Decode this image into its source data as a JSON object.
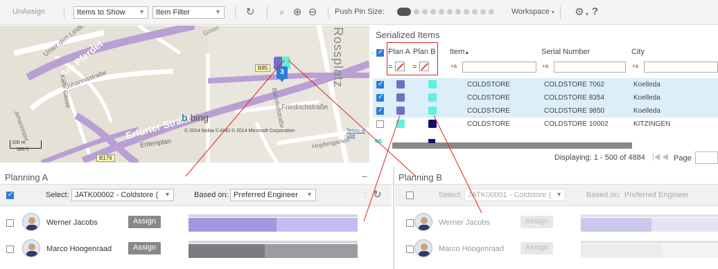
{
  "toolbar": {
    "unassign": "UnAssign",
    "items_to_show": "Items to Show",
    "item_filter": "Item Filter",
    "push_pin_size": "Push Pin Size:",
    "workspace": "Workspace",
    "help": "?"
  },
  "map": {
    "streets": [
      "Unter den Linden",
      "Am Pferdet",
      "Johannisstraße",
      "Kalte Gasse",
      "Erfurter Straße",
      "Entenplan",
      "Rossplatz",
      "Friedrichstraße",
      "Bahnhofstraße",
      "Hopfengarten",
      "Johannistor",
      "Gotter"
    ],
    "road_badges": [
      "B85",
      "B176"
    ],
    "pin_count": "3",
    "bing": "bing",
    "copyright": "© 2014 Nokia © AND © 2014 Microsoft Corporation",
    "terms": "Terms of Use",
    "scale_m": "100 m",
    "scale_ft": "500 ft"
  },
  "grid": {
    "title": "Serialized Items",
    "columns": {
      "plan_a": "Plan A",
      "plan_b": "Plan B",
      "item": "Item",
      "serial": "Serial Number",
      "city": "City"
    },
    "filter_op": "=",
    "text_op": "+a",
    "rows": [
      {
        "checked": true,
        "plan_a": "#6f6fc8",
        "plan_b": "#5ff0e0",
        "item": "COLDSTORE",
        "serial": "COLDSTORE 7062",
        "city": "Koelleda",
        "selected": true
      },
      {
        "checked": true,
        "plan_a": "#6f6fc8",
        "plan_b": "#5ff0e0",
        "item": "COLDSTORE",
        "serial": "COLDSTORE 8354",
        "city": "Koelleda",
        "selected": true
      },
      {
        "checked": true,
        "plan_a": "#6f6fc8",
        "plan_b": "#5ff0e0",
        "item": "COLDSTORE",
        "serial": "COLDSTORE 9850",
        "city": "Koelleda",
        "selected": true
      },
      {
        "checked": false,
        "plan_a": "#5ff0e0",
        "plan_b": "#10106a",
        "item": "COLDSTORE",
        "serial": "COLDSTORE 10002",
        "city": "KITZINGEN",
        "selected": false
      }
    ],
    "displaying": "Displaying: 1 - 500 of 4884",
    "page_label": "Page"
  },
  "planning_a": {
    "title": "Planning A",
    "select_label": "Select:",
    "select_value": "JATK00002 - Coldstore (",
    "based_on_label": "Based on:",
    "based_on_value": "Preferred Engineer",
    "engineers": [
      {
        "name": "Werner Jacobs",
        "assign": "Assign",
        "bar_fill": 0.52
      },
      {
        "name": "Marco Hoogenraad",
        "assign": "Assign",
        "bar_fill": 0.45
      }
    ]
  },
  "planning_b": {
    "title": "Planning B",
    "select_label": "Select:",
    "select_value": "JATK00001 - Coldstore (",
    "based_on_label": "Based on:",
    "based_on_value": "Preferred Engineer",
    "engineers": [
      {
        "name": "Werner Jacobs",
        "assign": "Assign",
        "bar_fill": 0.42
      },
      {
        "name": "Marco Hoogenraad",
        "assign": "Assign",
        "bar_fill": 0.48
      }
    ]
  },
  "colors": {
    "plan_a": "#6f6fc8",
    "plan_b": "#5ff0e0",
    "accent": "#2d7dd2",
    "annotation": "#e02020"
  }
}
